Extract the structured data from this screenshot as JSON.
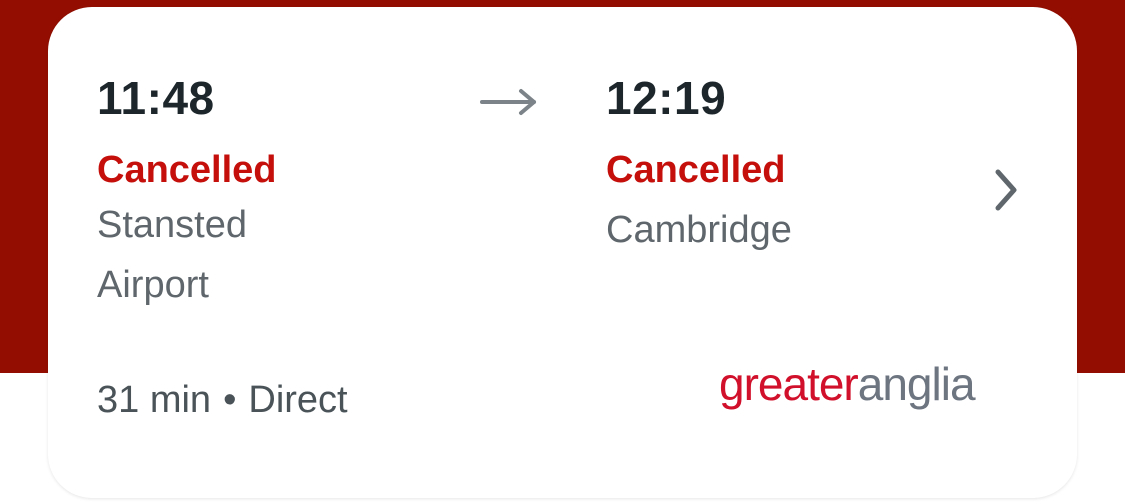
{
  "departure": {
    "time": "11:48",
    "status": "Cancelled",
    "station_line1": "Stansted",
    "station_line2": "Airport"
  },
  "arrival": {
    "time": "12:19",
    "status": "Cancelled",
    "station": "Cambridge"
  },
  "journey": {
    "duration": "31 min",
    "separator": "•",
    "type": "Direct"
  },
  "operator": {
    "logo_part1": "greater",
    "logo_part2": "anglia"
  },
  "icons": {
    "arrow": "arrow-right-icon",
    "chevron": "chevron-right-icon"
  },
  "colors": {
    "header_background": "#930e00",
    "status_cancelled": "#c40f0a",
    "logo_red": "#d1102b",
    "logo_grey": "#6d7581"
  }
}
